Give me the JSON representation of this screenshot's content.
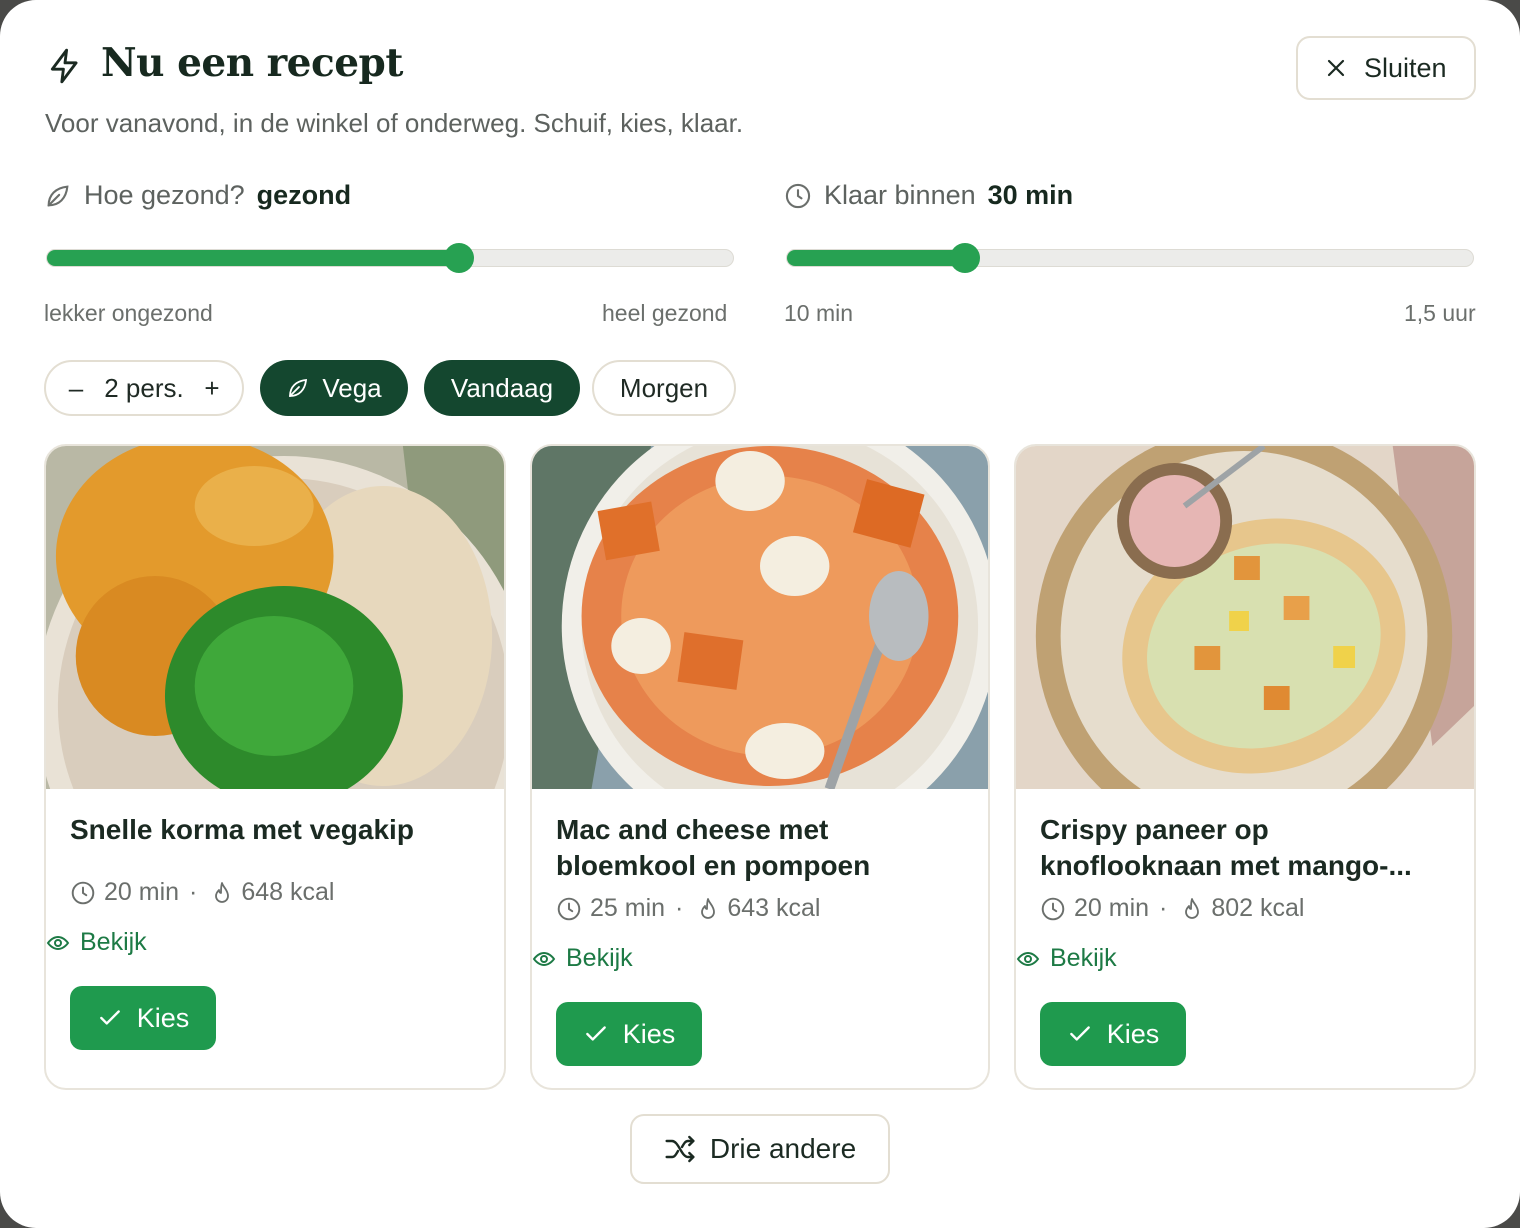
{
  "header": {
    "title": "Nu een recept",
    "subtitle": "Voor vanavond, in de winkel of onderweg. Schuif, kies, klaar.",
    "close_label": "Sluiten"
  },
  "health_slider": {
    "label": "Hoe gezond?",
    "value_label": "gezond",
    "level": 0.6,
    "min_label": "lekker ongezond",
    "max_label": "heel gezond"
  },
  "time_slider": {
    "label": "Klaar binnen",
    "value_label": "30 min",
    "level": 0.26,
    "min_label": "10 min",
    "max_label": "1,5 uur"
  },
  "filters": {
    "persons_label": "2 pers.",
    "minus": "–",
    "plus": "+",
    "vega": "Vega",
    "today": "Vandaag",
    "tomorrow": "Morgen"
  },
  "recipes": [
    {
      "title": "Snelle korma met vegakip",
      "time": "20 min",
      "kcal": "648 kcal",
      "view": "Bekijk",
      "choose": "Kies"
    },
    {
      "title": "Mac and cheese met bloemkool en pompoen",
      "time": "25 min",
      "kcal": "643 kcal",
      "view": "Bekijk",
      "choose": "Kies"
    },
    {
      "title": "Crispy paneer op knoflooknaan met mango-...",
      "time": "20 min",
      "kcal": "802 kcal",
      "view": "Bekijk",
      "choose": "Kies"
    }
  ],
  "meta_separator": "·",
  "shuffle_label": "Drie andere",
  "colors": {
    "accent": "#27a152",
    "chip_dark": "#14472f",
    "link": "#1d7a45"
  }
}
